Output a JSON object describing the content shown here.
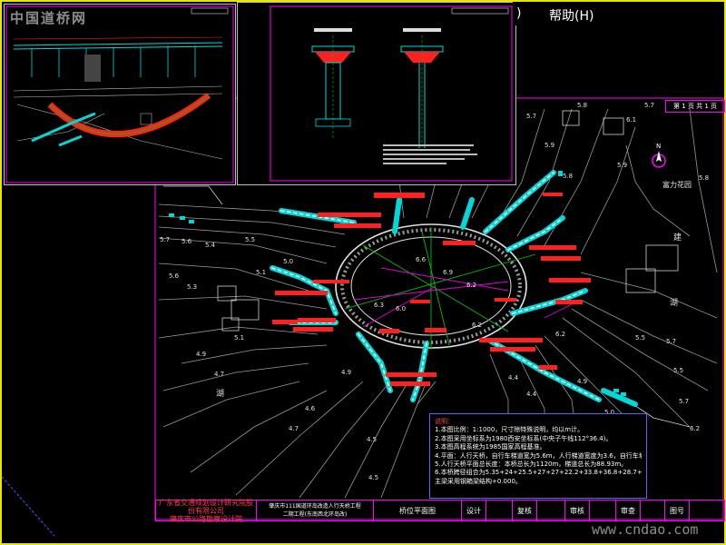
{
  "menu": {
    "paren": ")",
    "help": "帮助(H)"
  },
  "watermarks": {
    "top_left": "中国道桥网",
    "bottom_right": "www.cndao.com"
  },
  "compass": {
    "label": "N"
  },
  "map_labels": {
    "garden": "富力花园",
    "lake_west": "湖",
    "lake_east": "湖",
    "building": "建"
  },
  "notes": {
    "title": "说明：",
    "lines": [
      "1.本图比例：1:1000，尺寸除特殊说明，均以m计。",
      "2.本图采用坐标系为1980西安坐标系(中央子午线112°36.4)。",
      "3.本图高程系统为1985国家高程基准。",
      "4.平面：人行天桥，自行车梯道宽为5.6m，人行梯道宽度为3.6，自行车坡度为1:6。",
      "5.人行天桥平面总长度：本桥总长为1120m，梯道总长为88.93m。",
      "6.本桥跨径组合为5.35+24+25.5+27+27+22.2+33.8+36.8+28.7+22+21.5+21+32.5m，详见桥型图。",
      "  主梁采用钢箱梁结构+0.000。"
    ]
  },
  "title_block": {
    "company": "广东省交通规划设计研究院股份有限公司",
    "branch": "肇庆市公路勘察设计院",
    "project_line1": "肇庆市111国道环岛改造人行天桥工程",
    "project_line2": "二期工程(东南西北环岛改)",
    "drawing_name": "桥位平面图",
    "design": "设计",
    "review": "复核",
    "audit": "审核",
    "approve": "审查",
    "drawing_no": "图号"
  },
  "sheet": {
    "label": "第 1 页 共 1 页"
  },
  "colors": {
    "border": "#e6e600",
    "frame": "#ff00ff",
    "road": "#c0c0c0",
    "bridge": "#00e0e0",
    "annotation": "#ff2020",
    "axis": "#00c000",
    "notes_border": "#6060ff"
  }
}
